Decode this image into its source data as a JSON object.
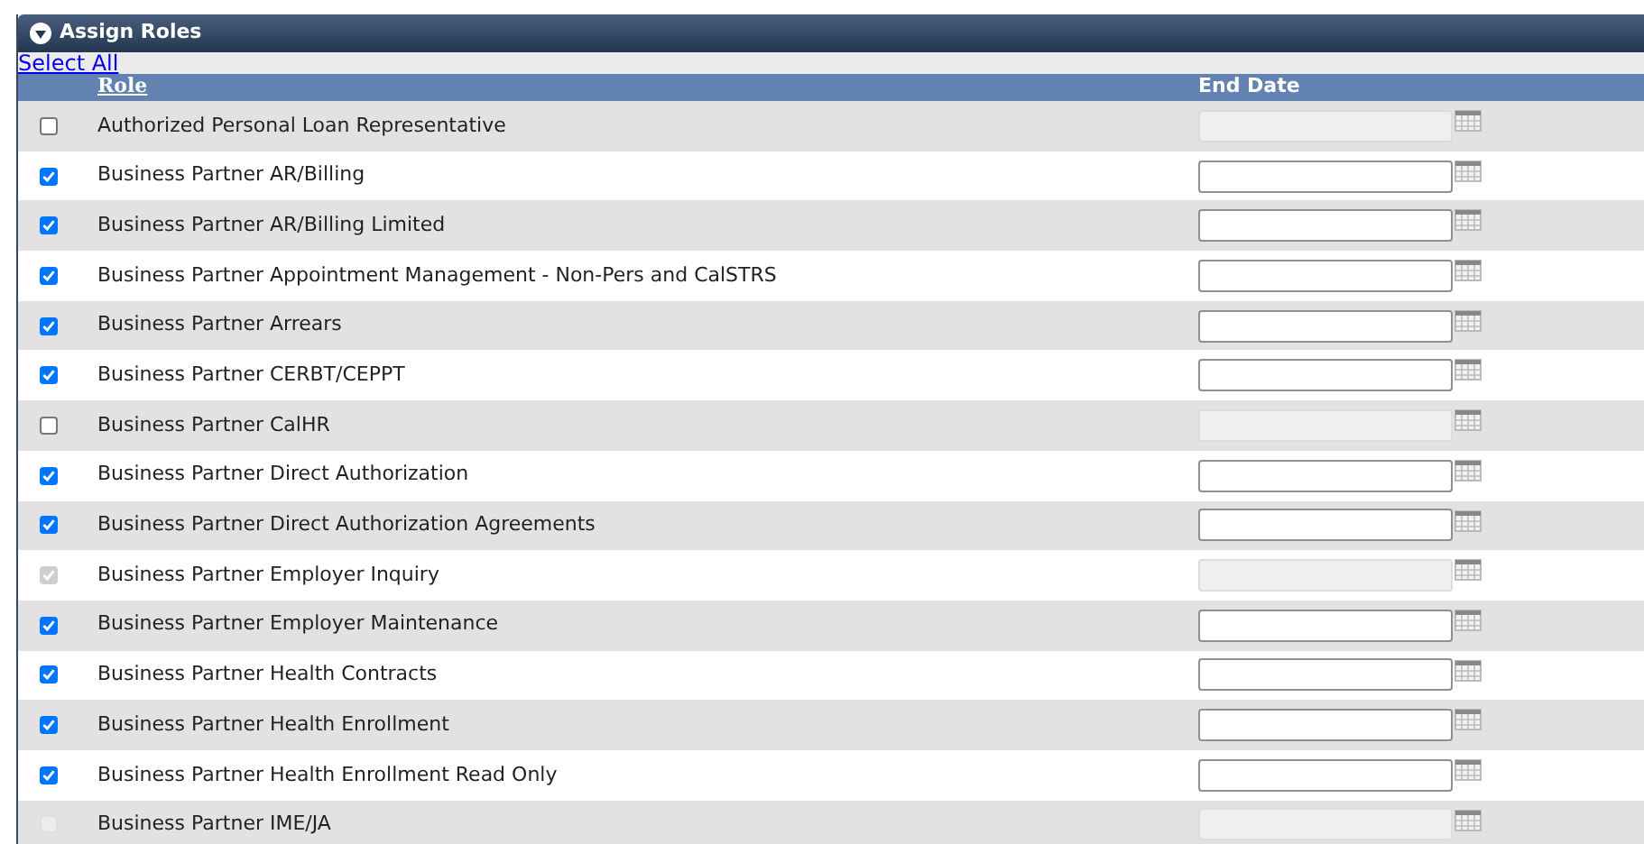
{
  "panel": {
    "title": "Assign Roles",
    "expanded": true
  },
  "select_all": "Select All",
  "table": {
    "columns": [
      "Role",
      "End Date"
    ],
    "rows": [
      {
        "role": "Authorized Personal Loan Representative",
        "checked": false,
        "disabled": false,
        "date_disabled": true
      },
      {
        "role": "Business Partner AR/Billing",
        "checked": true,
        "disabled": false,
        "date_disabled": false
      },
      {
        "role": "Business Partner AR/Billing Limited",
        "checked": true,
        "disabled": false,
        "date_disabled": false
      },
      {
        "role": "Business Partner Appointment Management - Non-Pers and CalSTRS",
        "checked": true,
        "disabled": false,
        "date_disabled": false
      },
      {
        "role": "Business Partner Arrears",
        "checked": true,
        "disabled": false,
        "date_disabled": false
      },
      {
        "role": "Business Partner CERBT/CEPPT",
        "checked": true,
        "disabled": false,
        "date_disabled": false
      },
      {
        "role": "Business Partner CalHR",
        "checked": false,
        "disabled": false,
        "date_disabled": true
      },
      {
        "role": "Business Partner Direct Authorization",
        "checked": true,
        "disabled": false,
        "date_disabled": false
      },
      {
        "role": "Business Partner Direct Authorization Agreements",
        "checked": true,
        "disabled": false,
        "date_disabled": false
      },
      {
        "role": "Business Partner Employer Inquiry",
        "checked": true,
        "disabled": true,
        "date_disabled": true
      },
      {
        "role": "Business Partner Employer Maintenance",
        "checked": true,
        "disabled": false,
        "date_disabled": false
      },
      {
        "role": "Business Partner Health Contracts",
        "checked": true,
        "disabled": false,
        "date_disabled": false
      },
      {
        "role": "Business Partner Health Enrollment",
        "checked": true,
        "disabled": false,
        "date_disabled": false
      },
      {
        "role": "Business Partner Health Enrollment Read Only",
        "checked": true,
        "disabled": false,
        "date_disabled": false
      },
      {
        "role": "Business Partner IME/JA",
        "checked": false,
        "disabled": true,
        "date_disabled": true
      }
    ]
  }
}
